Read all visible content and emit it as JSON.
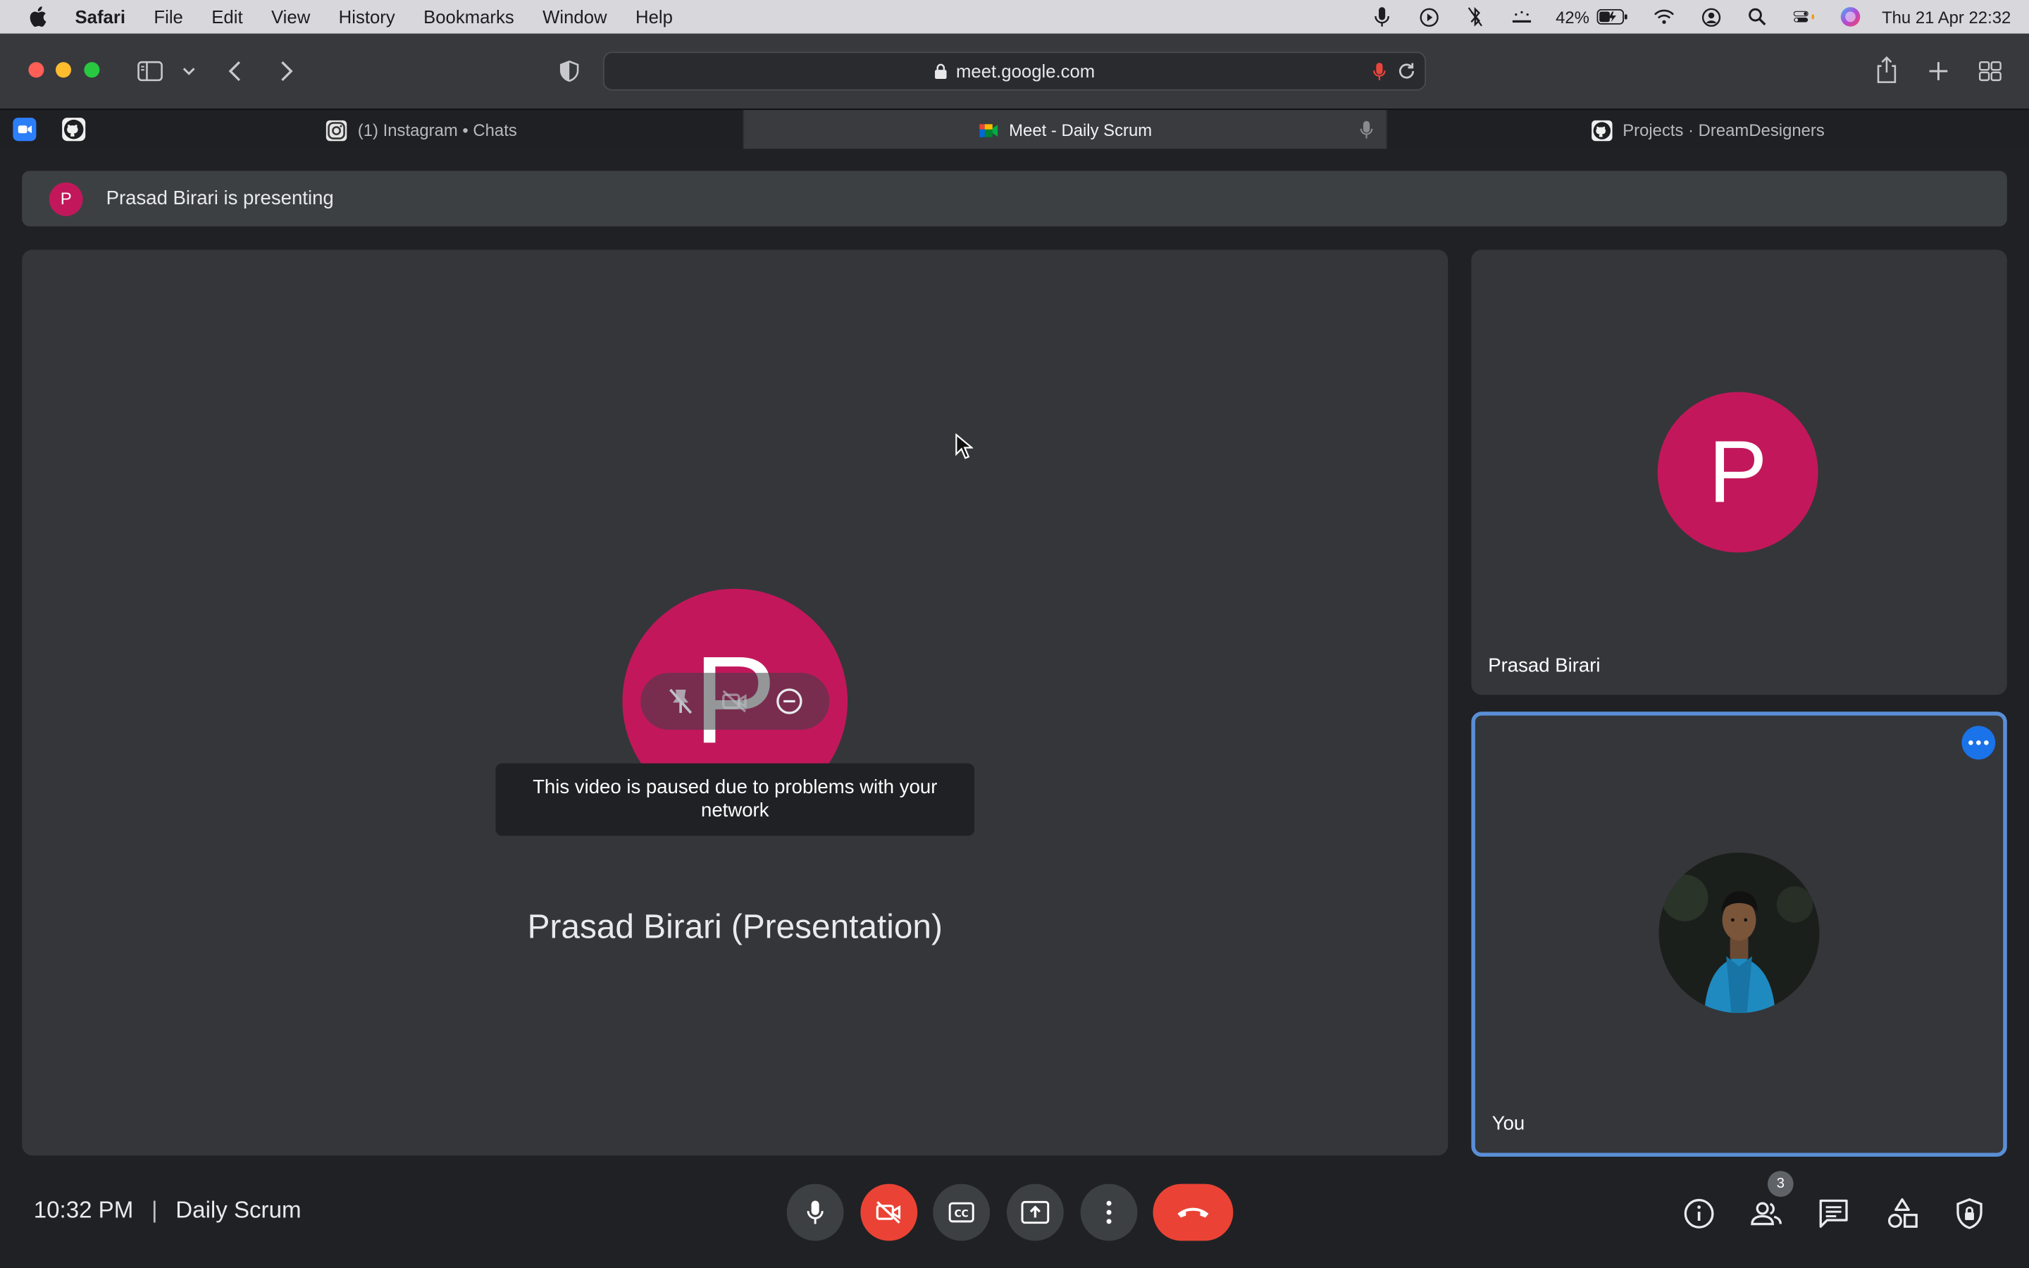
{
  "menubar": {
    "app_name": "Safari",
    "items": [
      "File",
      "Edit",
      "View",
      "History",
      "Bookmarks",
      "Window",
      "Help"
    ],
    "battery": "42%",
    "datetime": "Thu 21 Apr  22:32"
  },
  "browser": {
    "url": "meet.google.com",
    "tabs": [
      {
        "label": "(1) Instagram • Chats",
        "icon": "instagram-icon"
      },
      {
        "label": "Meet - Daily Scrum",
        "icon": "google-meet-icon",
        "active": true
      },
      {
        "label": "Projects · DreamDesigners",
        "icon": "github-icon"
      }
    ]
  },
  "meet": {
    "presenting_banner": "Prasad Birari is presenting",
    "presenter_initial": "P",
    "main_tile": {
      "avatar_initial": "P",
      "paused_message": "This video is paused due to problems with your network",
      "name": "Prasad Birari (Presentation)"
    },
    "participants": [
      {
        "name": "Prasad Birari",
        "initial": "P"
      },
      {
        "name": "You"
      }
    ],
    "bottom": {
      "time": "10:32 PM",
      "meeting_name": "Daily Scrum",
      "people_count": "3"
    },
    "colors": {
      "avatar": "#c2185b",
      "end_call": "#ea4335",
      "accent": "#1a73e8"
    }
  }
}
